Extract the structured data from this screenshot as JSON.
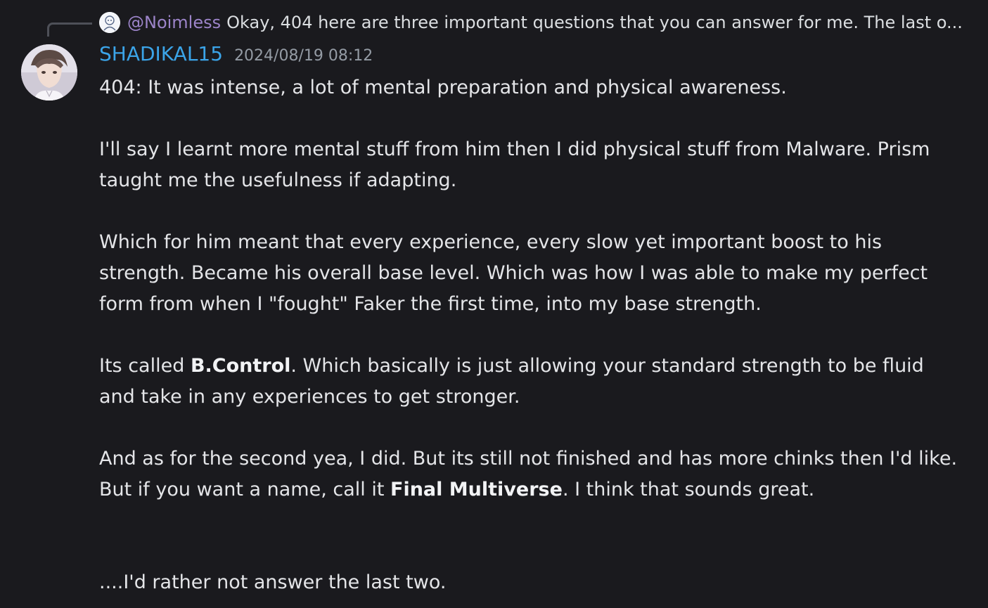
{
  "reply": {
    "author": "@Noimless",
    "text": "Okay, 404 here are three important questions that you can answer for me. The last o..."
  },
  "message": {
    "username": "SHADIKAL15",
    "timestamp": "2024/08/19 08:12",
    "p1": "404: It was intense, a lot of mental preparation and physical awareness.",
    "p2": "I'll say I learnt more mental stuff from him then I did physical stuff from Malware. Prism taught me the usefulness if adapting.",
    "p3": "Which for him meant that every experience, every slow yet important boost to his strength. Became his overall base level. Which was how I was able to make my perfect form from when I \"fought\" Faker the first time, into my base strength.",
    "p4_pre": "Its called ",
    "p4_bold": "B.Control",
    "p4_post": ". Which basically is just allowing your standard strength to be fluid and take in any experiences to get stronger.",
    "p5_pre": "And as for the second yea, I did. But its still not finished and has more chinks then I'd like. But if you want a name, call it ",
    "p5_bold": "Final Multiverse",
    "p5_post": ". I think that sounds great.",
    "p6": "....I'd rather not answer the last two."
  }
}
